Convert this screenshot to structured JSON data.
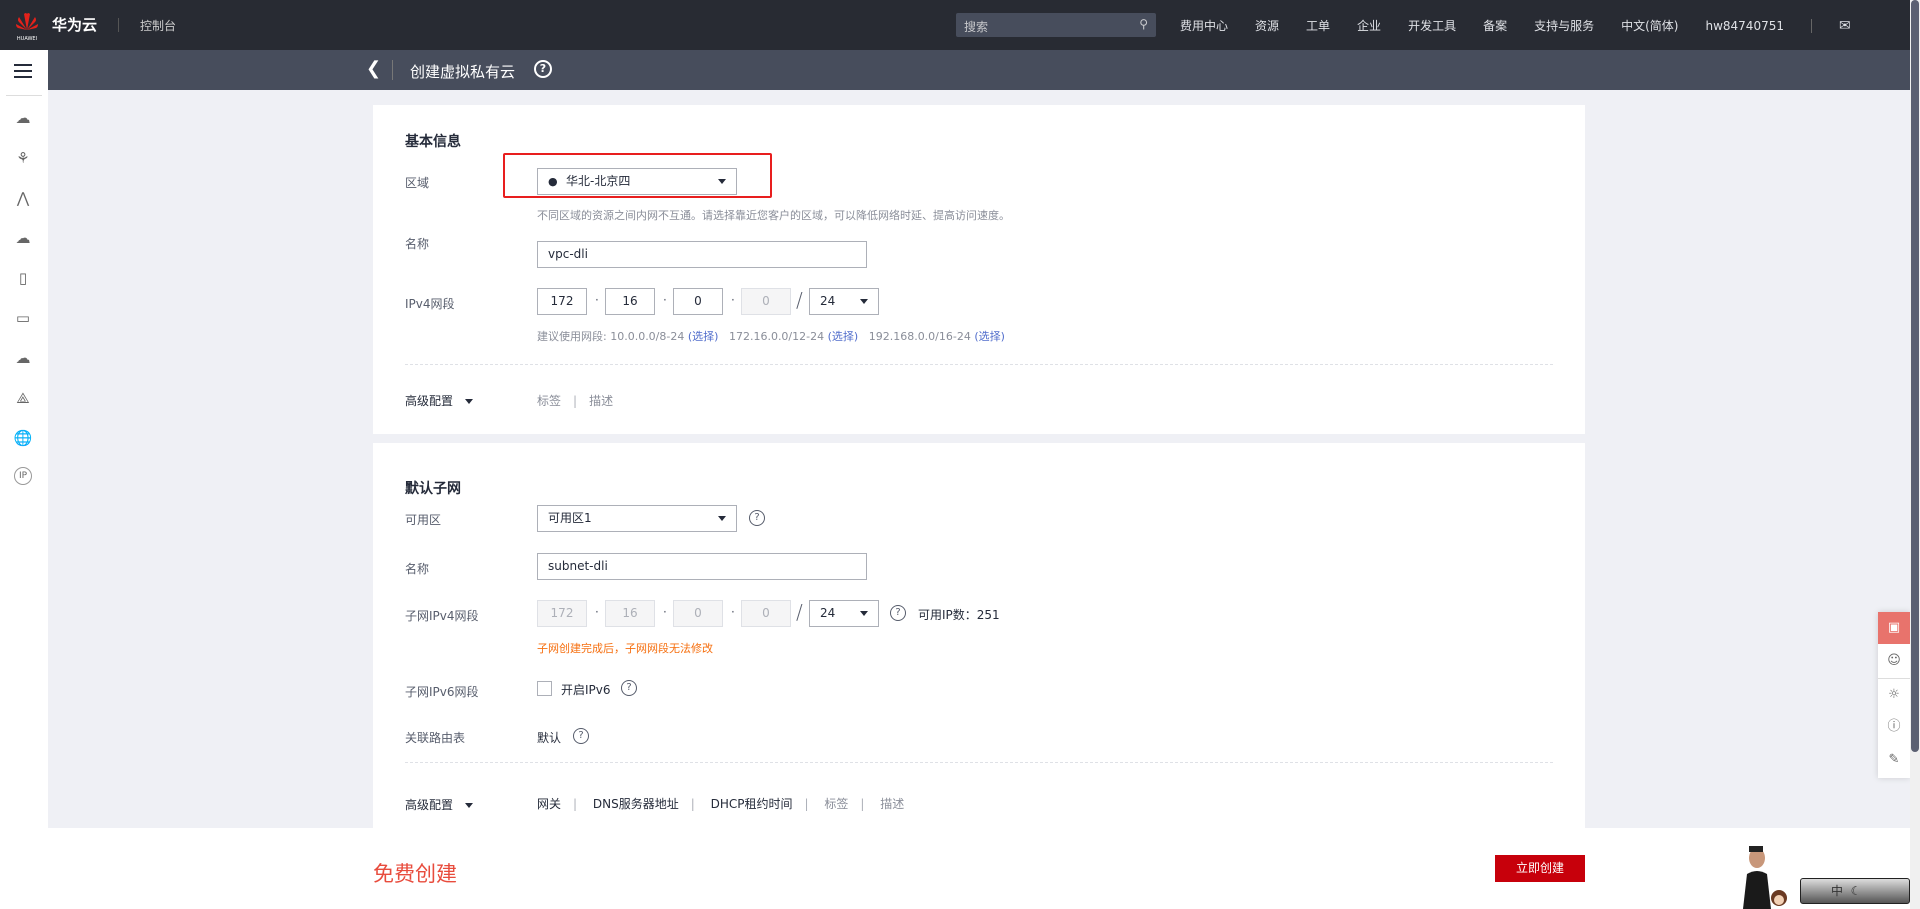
{
  "header": {
    "logo_text": "HUAWEI",
    "brand": "华为云",
    "console": "控制台",
    "search_placeholder": "搜索",
    "nav": [
      "费用中心",
      "资源",
      "工单",
      "企业",
      "开发工具",
      "备案",
      "支持与服务",
      "中文(简体)",
      "hw84740751"
    ]
  },
  "page": {
    "title": "创建虚拟私有云"
  },
  "basic": {
    "title": "基本信息",
    "region_label": "区域",
    "region_value": "华北-北京四",
    "region_hint": "不同区域的资源之间内网不互通。请选择靠近您客户的区域，可以降低网络时延、提高访问速度。",
    "name_label": "名称",
    "name_value": "vpc-dli",
    "ipv4_label": "IPv4网段",
    "ipv4": [
      "172",
      "16",
      "0",
      "0"
    ],
    "mask": "24",
    "suggest_prefix": "建议使用网段: ",
    "suggest": [
      "10.0.0.0/8-24",
      "172.16.0.0/12-24",
      "192.168.0.0/16-24"
    ],
    "select_link": "(选择)",
    "advanced": "高级配置",
    "tabs": [
      "标签",
      "描述"
    ]
  },
  "subnet": {
    "title": "默认子网",
    "az_label": "可用区",
    "az_value": "可用区1",
    "name_label": "名称",
    "name_value": "subnet-dli",
    "ipv4_label": "子网IPv4网段",
    "ipv4": [
      "172",
      "16",
      "0",
      "0"
    ],
    "mask": "24",
    "available_ips": "可用IP数：251",
    "warning": "子网创建完成后，子网网段无法修改",
    "ipv6_label": "子网IPv6网段",
    "ipv6_checkbox": "开启IPv6",
    "ipv6_checked": false,
    "route_label": "关联路由表",
    "route_value": "默认",
    "advanced": "高级配置",
    "tabs": [
      "网关",
      "DNS服务器地址",
      "DHCP租约时间",
      "标签",
      "描述"
    ]
  },
  "footer": {
    "free": "免费创建",
    "create": "立即创建"
  },
  "tray": {
    "ime": "中"
  },
  "colors": {
    "accent": "#c7000b",
    "header": "#282b33",
    "warning": "#f66f0f",
    "link": "#526ecc"
  }
}
